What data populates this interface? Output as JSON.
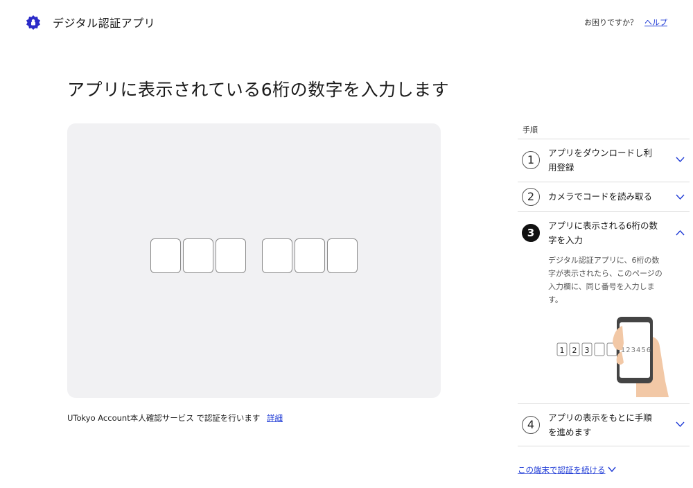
{
  "header": {
    "app_title": "デジタル認証アプリ",
    "help_question": "お困りですか？",
    "help_link": "ヘルプ"
  },
  "main": {
    "title": "アプリに表示されている6桁の数字を入力します",
    "code_boxes": [
      "",
      "",
      "",
      "",
      "",
      ""
    ],
    "footer_note": "UTokyo Account本人確認サービス で認証を行います",
    "footer_link": "詳細"
  },
  "steps": {
    "heading": "手順",
    "items": [
      {
        "number": "1",
        "label": "アプリをダウンロードし利用登録",
        "line1": "アプリをダウンロードし利",
        "line2": "用登録",
        "expanded": false
      },
      {
        "number": "2",
        "label": "カメラでコードを読み取る",
        "expanded": false
      },
      {
        "number": "3",
        "line1": "アプリに表示される6桁の数",
        "line2": "字を入力",
        "expanded": true,
        "desc_line1": "デジタル認証アプリに、6桁の数",
        "desc_line2": "字が表示されたら、このページの",
        "desc_line3": "入力欄に、同じ番号を入力しま",
        "desc_line4": "す。",
        "illustration_digits": [
          "1",
          "2",
          "3",
          "",
          ""
        ],
        "phone_code": "123456"
      },
      {
        "number": "4",
        "line1": "アプリの表示をもとに手順",
        "line2": "を進めます",
        "expanded": false
      }
    ],
    "continue_link": "この端末で認証を続ける"
  },
  "colors": {
    "accent": "#1f3bd6",
    "logo": "#2b2bc8",
    "panel_bg": "#f1f1f3",
    "skin": "#f2c8a6",
    "phone": "#444444"
  },
  "icons": {
    "logo": "shield-lock-icon",
    "chevron_down": "chevron-down-icon",
    "chevron_up": "chevron-up-icon"
  }
}
